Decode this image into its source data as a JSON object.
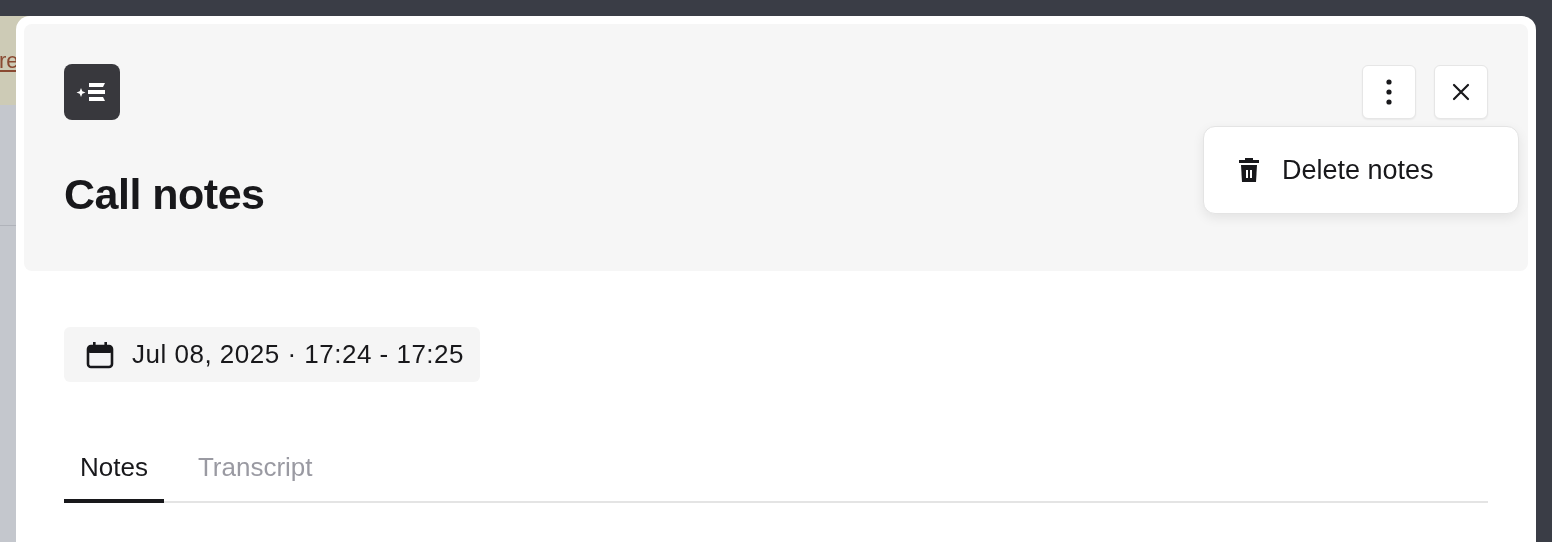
{
  "background": {
    "link_fragment": "re"
  },
  "dialog": {
    "title": "Call notes",
    "header_buttons": [
      {
        "kind": "more"
      },
      {
        "kind": "close"
      }
    ],
    "menu": {
      "items": [
        {
          "label": "Delete notes",
          "kind": "delete"
        }
      ]
    },
    "date_range": "Jul 08, 2025 · 17:24 - 17:25",
    "tabs": [
      {
        "label": "Notes",
        "selected": true
      },
      {
        "label": "Transcript",
        "selected": false
      }
    ]
  }
}
